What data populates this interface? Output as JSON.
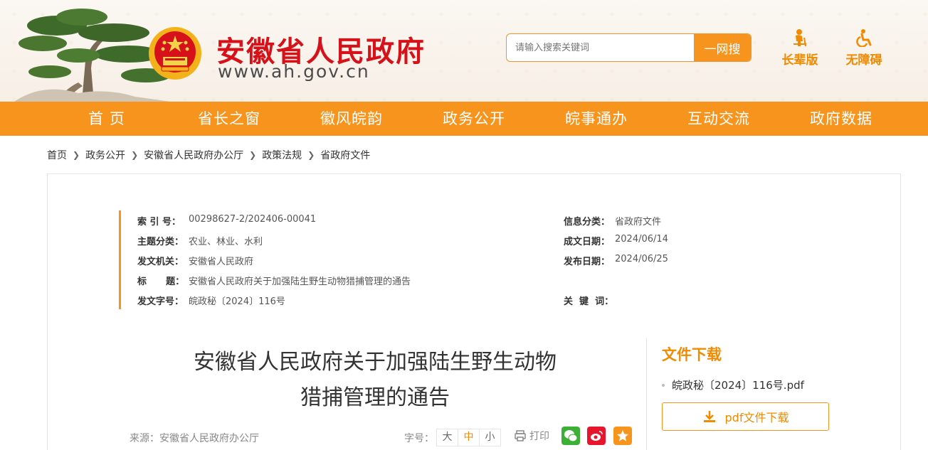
{
  "site": {
    "title": "安徽省人民政府",
    "url": "www.ah.gov.cn"
  },
  "search": {
    "placeholder": "请输入搜索关键词",
    "button": "一网搜"
  },
  "quick_links": [
    {
      "label": "长辈版",
      "icon": "elder-icon"
    },
    {
      "label": "无障碍",
      "icon": "accessibility-icon"
    }
  ],
  "nav": [
    "首 页",
    "省长之窗",
    "徽风皖韵",
    "政务公开",
    "皖事通办",
    "互动交流",
    "政府数据"
  ],
  "breadcrumb": [
    "首页",
    "政务公开",
    "安徽省人民政府办公厅",
    "政策法规",
    "省政府文件"
  ],
  "meta": {
    "index_label": "索  引  号：",
    "index_value": "00298627-2/202406-00041",
    "category_label": "信息分类：",
    "category_value": "省政府文件",
    "topic_label": "主题分类：",
    "topic_value": "农业、林业、水利",
    "created_label": "成文日期：",
    "created_value": "2024/06/14",
    "issuer_label": "发文机关：",
    "issuer_value": "安徽省人民政府",
    "published_label": "发布日期：",
    "published_value": "2024/06/25",
    "title_label": "标      题：",
    "title_value": "安徽省人民政府关于加强陆生野生动物猎捕管理的通告",
    "docno_label": "发文字号：",
    "docno_value": "皖政秘〔2024〕116号",
    "keywords_label": "关  键  词：",
    "keywords_value": ""
  },
  "document": {
    "title_line1": "安徽省人民政府关于加强陆生野生动物",
    "title_line2": "猎捕管理的通告",
    "source": "来源：安徽省人民政府办公厅",
    "font_label": "字号：",
    "font_sizes": [
      "大",
      "中",
      "小"
    ],
    "print_label": "打印"
  },
  "sidebar": {
    "title": "文件下载",
    "file_name": "皖政秘〔2024〕116号.pdf",
    "download_label": "pdf文件下载"
  },
  "colors": {
    "brand_orange": "#f7941d",
    "title_red": "#d7111a",
    "wechat": "#3cb034",
    "weibo": "#e6162d",
    "favorite": "#f7941d"
  }
}
